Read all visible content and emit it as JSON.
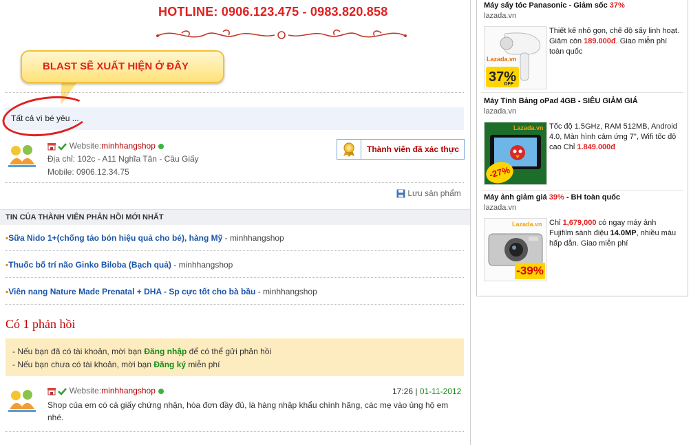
{
  "hotline": "HOTLINE: 0906.123.475 - 0983.820.858",
  "blast_label": "BLAST SẼ XUẤT HIỆN Ở ĐÂY",
  "tagline": "Tất cả vì bé yêu ...",
  "shop": {
    "website_label": "Website:",
    "website_name": "minhhangshop",
    "address": "Địa chỉ: 102c - A11 Nghĩa Tân - Cầu Giấy",
    "mobile": "Mobile: 0906.12.34.75",
    "verified_label": "Thành viên đã xác thực",
    "save_label": "Lưu sản phẩm"
  },
  "news": {
    "heading": "TIN CỦA THÀNH VIÊN PHẢN HỒI MỚI NHẤT",
    "items": [
      {
        "title": "Sữa Nido 1+(chống táo bón hiệu quả cho bé), hàng Mỹ",
        "sep": " - ",
        "author": "minhhangshop"
      },
      {
        "title": "Thuốc bổ trí não Ginko Biloba (Bạch quả)",
        "sep": " - ",
        "author": "minhhangshop"
      },
      {
        "title": "Viên nang Nature Made Prenatal + DHA - Sp cực tốt cho bà bầu",
        "sep": " - ",
        "author": "minhhangshop"
      }
    ]
  },
  "reply": {
    "count_title": "Có 1 phản hồi",
    "notice_line1_pre": "- Nếu bạn đã có tài khoản, mời bạn ",
    "notice_line1_link": "Đăng nhập",
    "notice_line1_post": " để có thể gửi phản hồi",
    "notice_line2_pre": "- Nếu bạn chưa có tài khoản, mời bạn ",
    "notice_line2_link": "Đăng ký",
    "notice_line2_post": " miễn phí"
  },
  "comment": {
    "website_label": "Website:",
    "author": "minhhangshop",
    "time": "17:26",
    "sep": " | ",
    "date": "01-11-2012",
    "text": "Shop của em có cả giấy chứng nhận, hóa đơn đầy đủ, là hàng nhập khẩu chính hãng, các mẹ vào ủng hộ em nhé."
  },
  "ads": [
    {
      "title_pre": "Máy sấy tóc Panasonic - Giảm sốc ",
      "title_em": "37%",
      "title_post": "",
      "domain": "lazada.vn",
      "desc_pre": "Thiết kế nhỏ gọn, chế độ sấy linh hoạt. Giảm còn ",
      "desc_price": "189.000đ",
      "desc_post": ". Giao miễn phí toàn quốc",
      "badge": "37%",
      "badge_sub": "OFF",
      "brand": "Lazada.vn"
    },
    {
      "title_pre": "Máy Tính Bảng oPad 4GB - SIÊU GIẢM GIÁ",
      "title_em": "",
      "title_post": "",
      "domain": "lazada.vn",
      "desc_pre": "Tốc độ 1.5GHz, RAM 512MB, Android 4.0, Màn hình cảm ứng 7\", Wifi tốc độ cao Chỉ ",
      "desc_price": "1.849.000đ",
      "desc_post": "",
      "badge": "-27%",
      "badge_sub": "",
      "brand": "Lazada.vn"
    },
    {
      "title_pre": "Máy ảnh giảm giá ",
      "title_em": "39%",
      "title_post": " - BH toàn quốc",
      "domain": "lazada.vn",
      "desc_pre": "Chỉ ",
      "desc_price": "1,679,000",
      "desc_mid": " có ngay máy ảnh Fujifilm sành điệu ",
      "desc_bold": "14.0MP",
      "desc_post": ", nhiều màu hấp dẫn. Giao miễn phí",
      "badge": "-39%",
      "badge_sub": "",
      "brand": "Lazada.vn"
    }
  ],
  "colors": {
    "hotline": "#e02020",
    "link_blue": "#1a55a8",
    "verified_red": "#b40000",
    "notice_bg": "#fdecc0",
    "green_link": "#1a8a1a"
  }
}
